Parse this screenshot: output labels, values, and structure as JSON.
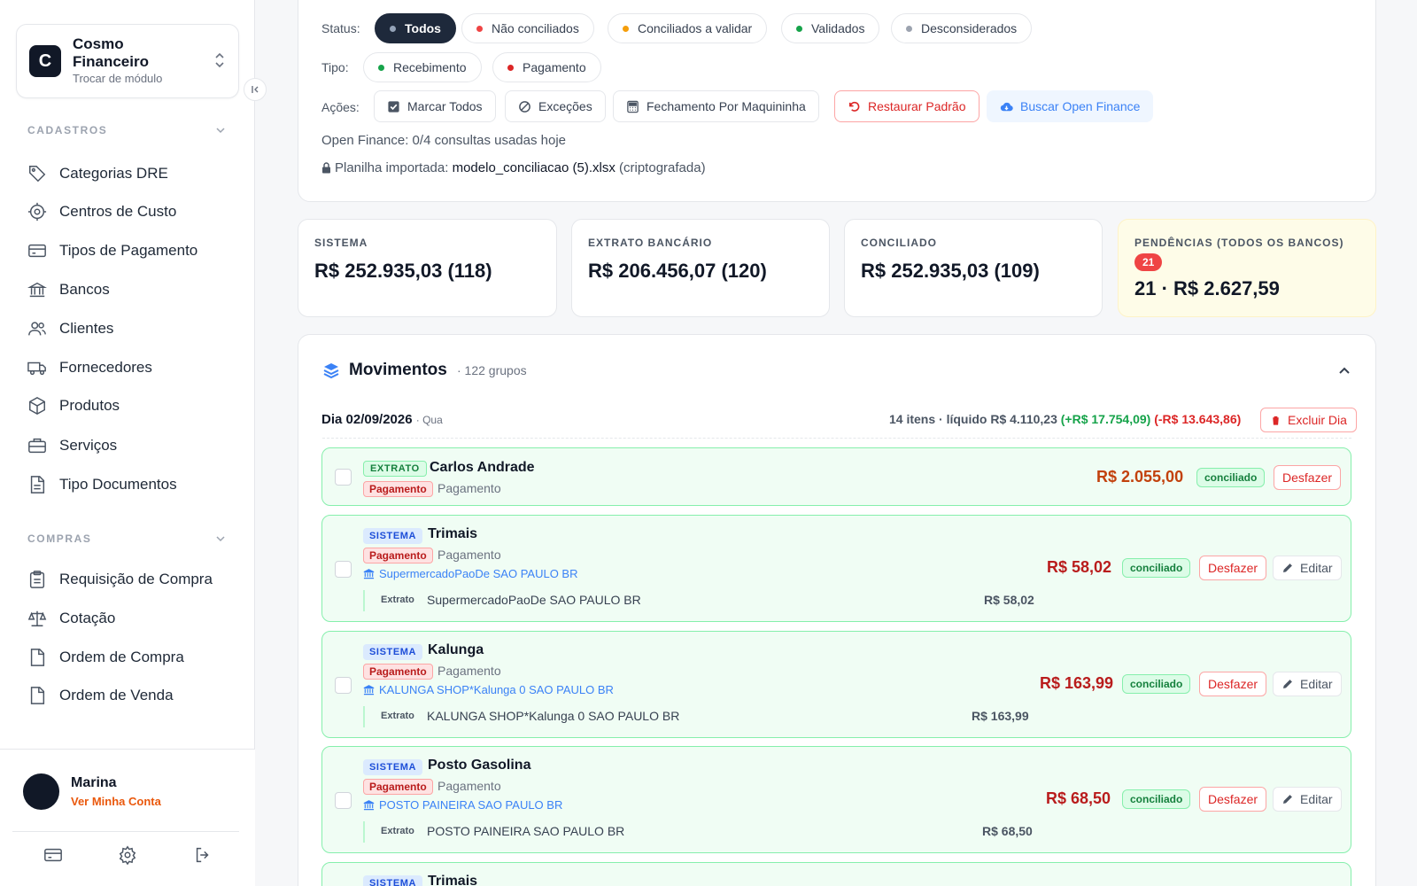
{
  "sidebar": {
    "module": {
      "logo_letter": "C",
      "name": "Cosmo Financeiro",
      "subtitle": "Trocar de módulo"
    },
    "sections": [
      {
        "title": "CADASTROS",
        "items": [
          {
            "label": "Categorias DRE",
            "icon": "tag-icon"
          },
          {
            "label": "Centros de Custo",
            "icon": "target-icon"
          },
          {
            "label": "Tipos de Pagamento",
            "icon": "credit-card-icon"
          },
          {
            "label": "Bancos",
            "icon": "bank-icon"
          },
          {
            "label": "Clientes",
            "icon": "users-icon"
          },
          {
            "label": "Fornecedores",
            "icon": "truck-icon"
          },
          {
            "label": "Produtos",
            "icon": "package-icon"
          },
          {
            "label": "Serviços",
            "icon": "briefcase-icon"
          },
          {
            "label": "Tipo Documentos",
            "icon": "file-text-icon"
          }
        ]
      },
      {
        "title": "COMPRAS",
        "items": [
          {
            "label": "Requisição de Compra",
            "icon": "clipboard-icon"
          },
          {
            "label": "Cotação",
            "icon": "scale-icon"
          },
          {
            "label": "Ordem de Compra",
            "icon": "file-icon"
          },
          {
            "label": "Ordem de Venda",
            "icon": "file-icon"
          }
        ]
      }
    ],
    "user": {
      "name": "Marina",
      "link": "Ver Minha Conta"
    }
  },
  "filters": {
    "status_label": "Status:",
    "status_options": [
      {
        "label": "Todos",
        "dot": "#94a3b8",
        "active": true
      },
      {
        "label": "Não conciliados",
        "dot": "#ef4444"
      },
      {
        "label": "Conciliados a validar",
        "dot": "#f59e0b"
      },
      {
        "label": "Validados",
        "dot": "#16a34a"
      },
      {
        "label": "Desconsiderados",
        "dot": "#9ca3af"
      }
    ],
    "tipo_label": "Tipo:",
    "tipo_options": [
      {
        "label": "Recebimento",
        "dot": "#16a34a"
      },
      {
        "label": "Pagamento",
        "dot": "#dc2626"
      }
    ],
    "acoes_label": "Ações:",
    "actions": [
      {
        "label": "Marcar Todos",
        "icon": "checkbox-icon"
      },
      {
        "label": "Exceções",
        "icon": "ban-icon"
      },
      {
        "label": "Fechamento Por Maquininha",
        "icon": "calculator-icon"
      },
      {
        "label": "Restaurar Padrão",
        "icon": "rotate-ccw-icon"
      },
      {
        "label": "Buscar Open Finance",
        "icon": "cloud-download-icon"
      }
    ],
    "open_finance_info": "Open Finance: 0/4 consultas usadas hoje",
    "spreadsheet_prefix": "Planilha importada:",
    "spreadsheet_file": "modelo_conciliacao (5).xlsx",
    "spreadsheet_suffix": "(criptografada)"
  },
  "stats": [
    {
      "label": "SISTEMA",
      "value": "R$ 252.935,03 (118)"
    },
    {
      "label": "EXTRATO BANCÁRIO",
      "value": "R$ 206.456,07 (120)"
    },
    {
      "label": "CONCILIADO",
      "value": "R$ 252.935,03 (109)"
    },
    {
      "label": "PENDÊNCIAS (TODOS OS BANCOS)",
      "badge": "21",
      "value": "21 · R$ 2.627,59"
    }
  ],
  "movimentos": {
    "title": "Movimentos",
    "count": "· 122 grupos",
    "day": {
      "title": "Dia 02/09/2026",
      "weekday": "· Qua",
      "summary_main": "14 itens · líquido R$ 4.110,23",
      "summary_pos": "(+R$ 17.754,09)",
      "summary_neg": "(-R$ 13.643,86)",
      "delete_label": "Excluir Dia"
    },
    "rows": [
      {
        "source": "EXTRATO",
        "name": "Carlos Andrade",
        "type_tag": "Pagamento",
        "type_text": "Pagamento",
        "amount": "R$ 2.055,00",
        "status": "conciliado",
        "undo": "Desfazer"
      },
      {
        "source": "SISTEMA",
        "name": "Trimais",
        "type_tag": "Pagamento",
        "type_text": "Pagamento",
        "bank": "SupermercadoPaoDe SAO PAULO BR",
        "sub_label": "Extrato",
        "sub_desc": "SupermercadoPaoDe SAO PAULO BR",
        "sub_amount": "R$ 58,02",
        "amount": "R$ 58,02",
        "status": "conciliado",
        "undo": "Desfazer",
        "edit": "Editar"
      },
      {
        "source": "SISTEMA",
        "name": "Kalunga",
        "type_tag": "Pagamento",
        "type_text": "Pagamento",
        "bank": "KALUNGA SHOP*Kalunga 0 SAO PAULO BR",
        "sub_label": "Extrato",
        "sub_desc": "KALUNGA SHOP*Kalunga 0 SAO PAULO BR",
        "sub_amount": "R$ 163,99",
        "amount": "R$ 163,99",
        "status": "conciliado",
        "undo": "Desfazer",
        "edit": "Editar"
      },
      {
        "source": "SISTEMA",
        "name": "Posto Gasolina",
        "type_tag": "Pagamento",
        "type_text": "Pagamento",
        "bank": "POSTO PAINEIRA SAO PAULO BR",
        "sub_label": "Extrato",
        "sub_desc": "POSTO PAINEIRA SAO PAULO BR",
        "sub_amount": "R$ 68,50",
        "amount": "R$ 68,50",
        "status": "conciliado",
        "undo": "Desfazer",
        "edit": "Editar"
      },
      {
        "source": "SISTEMA",
        "name": "Trimais"
      }
    ]
  }
}
